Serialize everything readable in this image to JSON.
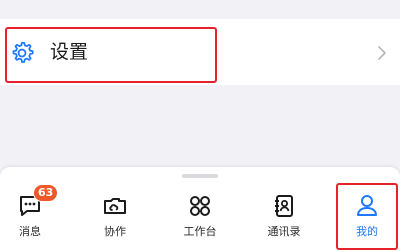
{
  "settings": {
    "label": "设置"
  },
  "tabbar": {
    "tabs": [
      {
        "label": "消息",
        "icon": "message-icon",
        "badge": "63"
      },
      {
        "label": "协作",
        "icon": "cloud-folder-icon"
      },
      {
        "label": "工作台",
        "icon": "workbench-grid-icon"
      },
      {
        "label": "通讯录",
        "icon": "contacts-book-icon"
      },
      {
        "label": "我的",
        "icon": "person-icon",
        "active": true
      }
    ]
  },
  "colors": {
    "accent": "#1e78ff",
    "badge": "#f0582a",
    "highlight": "#e8222b",
    "background": "#f1f1f6"
  }
}
